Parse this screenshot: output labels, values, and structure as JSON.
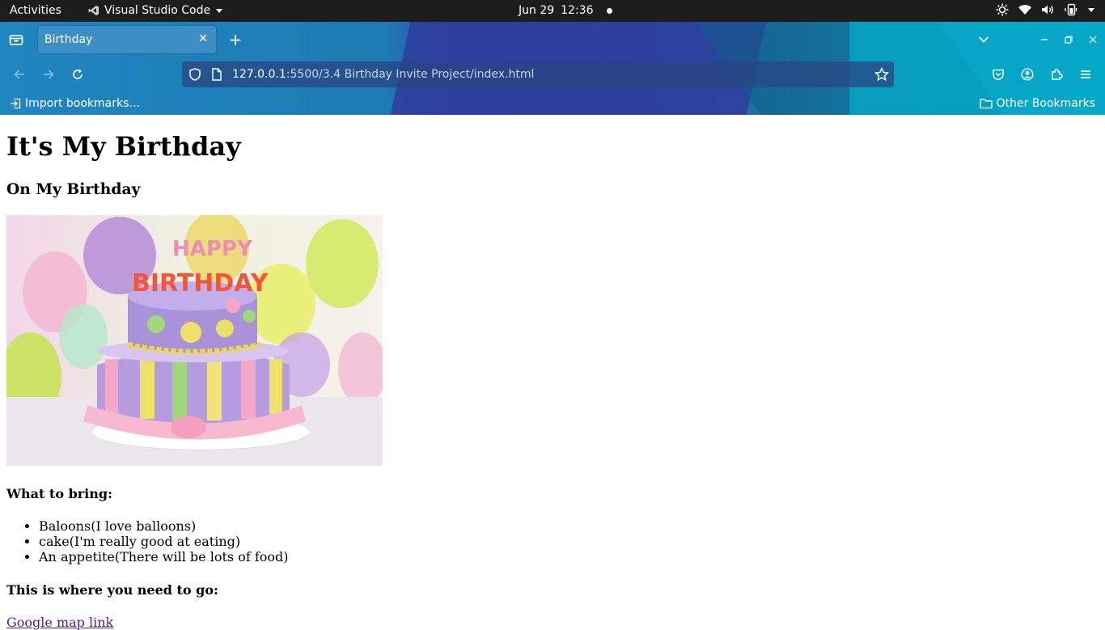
{
  "topbar": {
    "activities": "Activities",
    "app_name": "Visual Studio Code",
    "date": "Jun 29",
    "time": "12:36"
  },
  "browser": {
    "tab_title": "Birthday",
    "url_host": "127.0.0.1",
    "url_rest": ":5500/3.4 Birthday Invite Project/index.html",
    "import_bookmarks": "Import bookmarks…",
    "other_bookmarks": "Other Bookmarks"
  },
  "page": {
    "heading": "It's My Birthday",
    "subheading": "On My Birthday",
    "cake_text_top": "HAPPY",
    "cake_text_bottom": "BIRTHDAY",
    "bring_heading": "What to bring:",
    "bring_items": [
      "Baloons(I love balloons)",
      "cake(I'm really good at eating)",
      "An appetite(There will be lots of food)"
    ],
    "where_heading": "This is where you need to go:",
    "map_link": "Google map link"
  }
}
